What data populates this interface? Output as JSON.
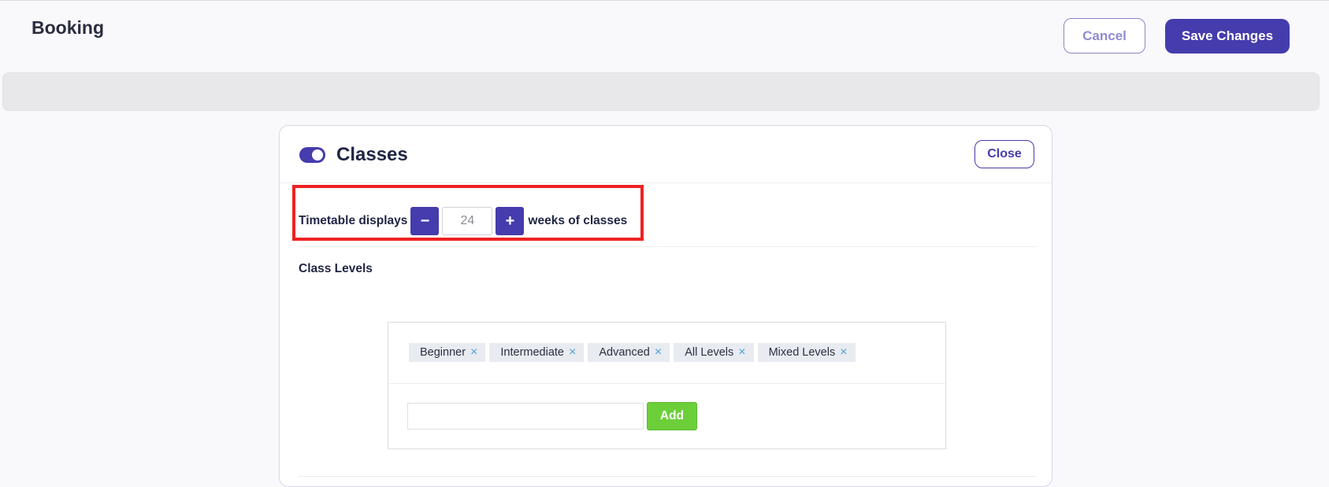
{
  "header": {
    "title": "Booking",
    "cancel_label": "Cancel",
    "save_label": "Save Changes"
  },
  "card": {
    "title": "Classes",
    "toggle_on": true,
    "close_label": "Close"
  },
  "timetable": {
    "prefix": "Timetable displays",
    "decrement_label": "−",
    "weeks_value": "24",
    "increment_label": "+",
    "suffix": "weeks of classes"
  },
  "class_levels": {
    "label": "Class Levels",
    "tags": [
      {
        "label": "Beginner",
        "remove_glyph": "×"
      },
      {
        "label": "Intermediate",
        "remove_glyph": "×"
      },
      {
        "label": "Advanced",
        "remove_glyph": "×"
      },
      {
        "label": "All Levels",
        "remove_glyph": "×"
      },
      {
        "label": "Mixed Levels",
        "remove_glyph": "×"
      }
    ],
    "new_level_value": "",
    "add_label": "Add"
  },
  "colors": {
    "primary": "#453cad",
    "add_button": "#6ccf3a",
    "highlight": "#ee2222",
    "tag_remove": "#4aa3d9"
  }
}
